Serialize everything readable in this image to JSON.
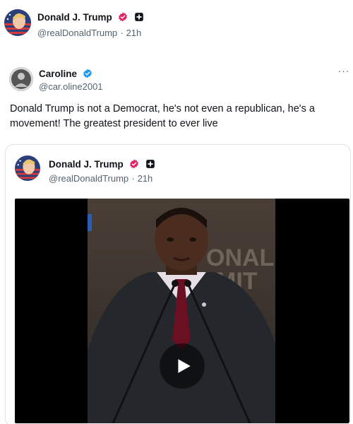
{
  "top_post": {
    "name": "Donald J. Trump",
    "handle": "@realDonaldTrump",
    "time": "21h",
    "separator": "·"
  },
  "tweet": {
    "name": "Caroline",
    "handle": "@car.oline2001",
    "body": "Donald Trump is not a Democrat, he's not even a republican, he's a movement! The greatest president to ever live",
    "more": "···"
  },
  "quoted": {
    "name": "Donald J. Trump",
    "handle": "@realDonaldTrump",
    "time": "21h",
    "separator": "·"
  },
  "video": {
    "backdrop_text_1": "ONAL",
    "backdrop_text_2": "MIT"
  },
  "colors": {
    "verified_gold_pink": "#e0245e",
    "verified_blue": "#1d9bf0",
    "text_primary": "#0f1419",
    "text_secondary": "#536471"
  },
  "icons": {
    "verified": "verified-badge-icon",
    "affiliate": "affiliate-badge-icon",
    "more": "more-options-icon",
    "play": "play-icon"
  }
}
